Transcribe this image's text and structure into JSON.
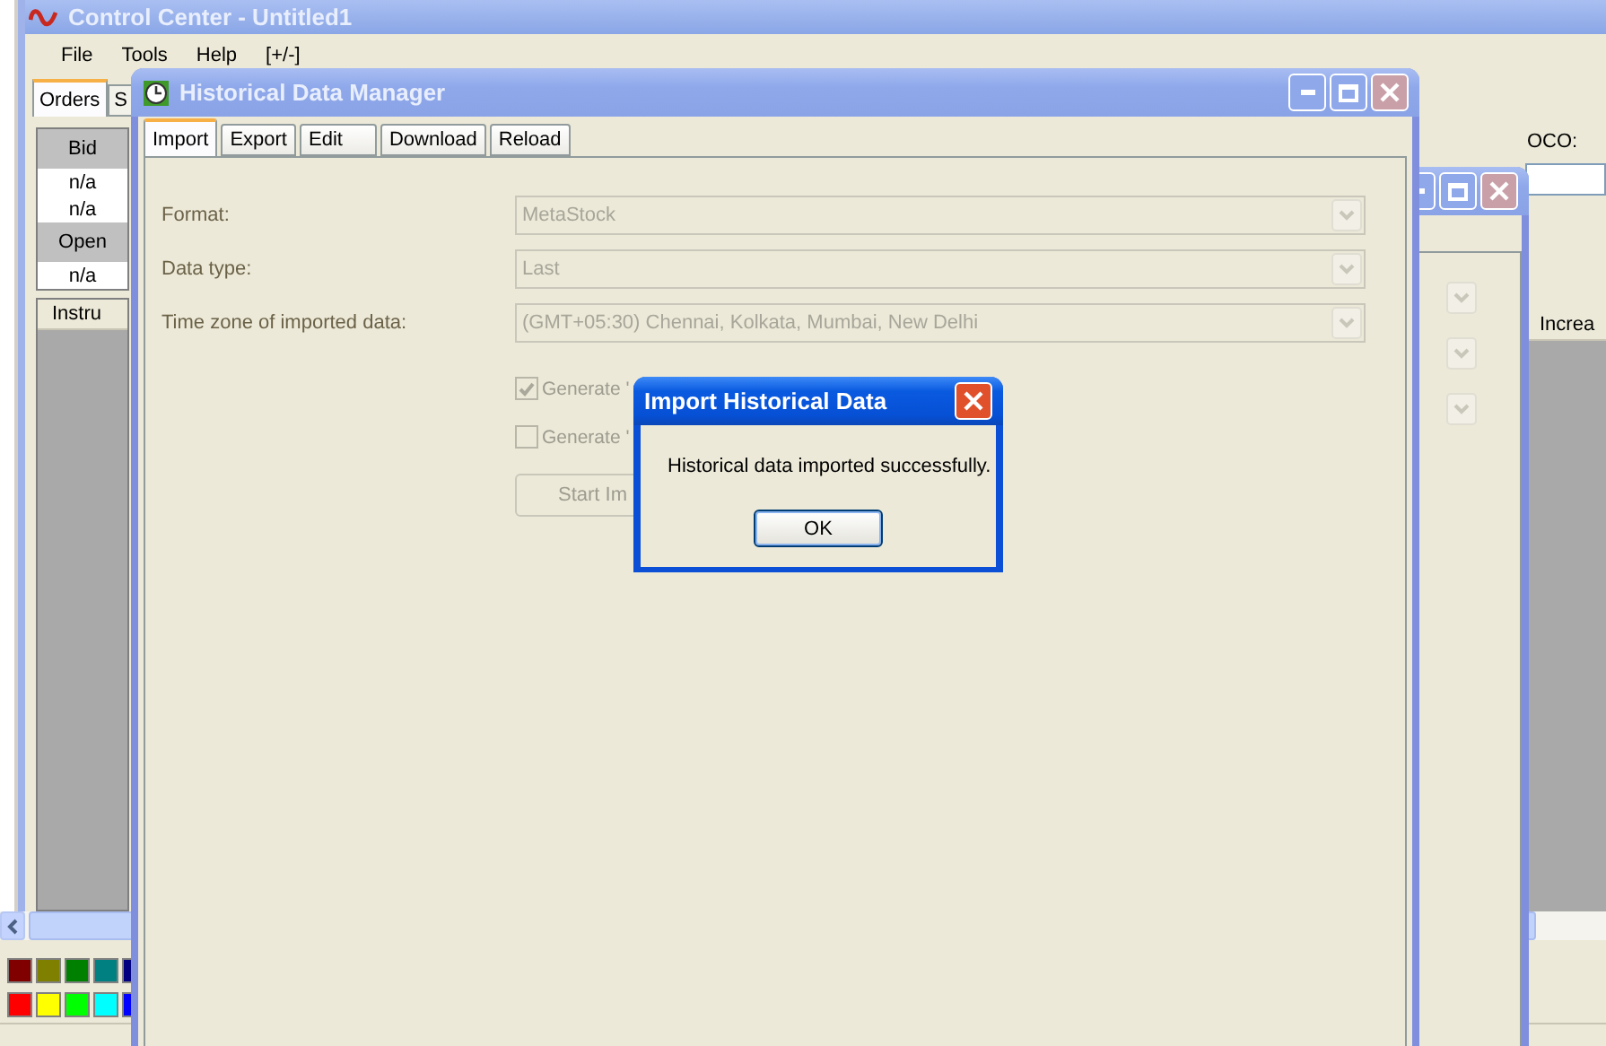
{
  "main_window": {
    "title": "Control Center - Untitled1",
    "menu": [
      "File",
      "Tools",
      "Help",
      "[+/-]"
    ],
    "tabs": [
      {
        "label": "Orders",
        "selected": true
      },
      {
        "label": "S",
        "selected": false
      }
    ],
    "quote_grid": [
      {
        "kind": "header",
        "text": "Bid"
      },
      {
        "kind": "value",
        "text": "n/a"
      },
      {
        "kind": "value",
        "text": "n/a"
      },
      {
        "kind": "header",
        "text": "Open"
      },
      {
        "kind": "value",
        "text": "n/a"
      }
    ],
    "oco_label": "OCO:",
    "table_columns": [
      "Instru",
      "Increa"
    ],
    "palette": [
      {
        "color": "#800000"
      },
      {
        "color": "#808000"
      },
      {
        "color": "#008000"
      },
      {
        "color": "#008080"
      },
      {
        "color": "#000080"
      },
      {
        "color": "#ff0000"
      },
      {
        "color": "#ffff00"
      },
      {
        "color": "#00ff00"
      },
      {
        "color": "#00ffff"
      },
      {
        "color": "#0000ff"
      }
    ]
  },
  "order_window": {
    "fields": [
      {
        "kind": "dropdown"
      },
      {
        "kind": "dropdown"
      },
      {
        "kind": "dropdown"
      }
    ]
  },
  "hdm_window": {
    "title": "Historical Data Manager",
    "tabs": [
      {
        "label": "Import",
        "selected": true
      },
      {
        "label": "Export",
        "selected": false
      },
      {
        "label": "Edit",
        "selected": false
      },
      {
        "label": "Download",
        "selected": false
      },
      {
        "label": "Reload",
        "selected": false
      }
    ],
    "fields": [
      {
        "label": "Format:",
        "value": "MetaStock",
        "disabled": true
      },
      {
        "label": "Data type:",
        "value": "Last",
        "disabled": true
      },
      {
        "label": "Time zone of imported data:",
        "value": "(GMT+05:30) Chennai, Kolkata, Mumbai, New Delhi",
        "disabled": true
      }
    ],
    "options": [
      {
        "label": "Generate '",
        "checked": true,
        "disabled": true
      },
      {
        "label": "Generate '",
        "checked": false,
        "disabled": true
      }
    ],
    "start_button": {
      "label": "Start Im",
      "disabled": true
    }
  },
  "dialog": {
    "title": "Import Historical Data",
    "message": "Historical data imported successfully.",
    "buttons": [
      "OK"
    ]
  }
}
